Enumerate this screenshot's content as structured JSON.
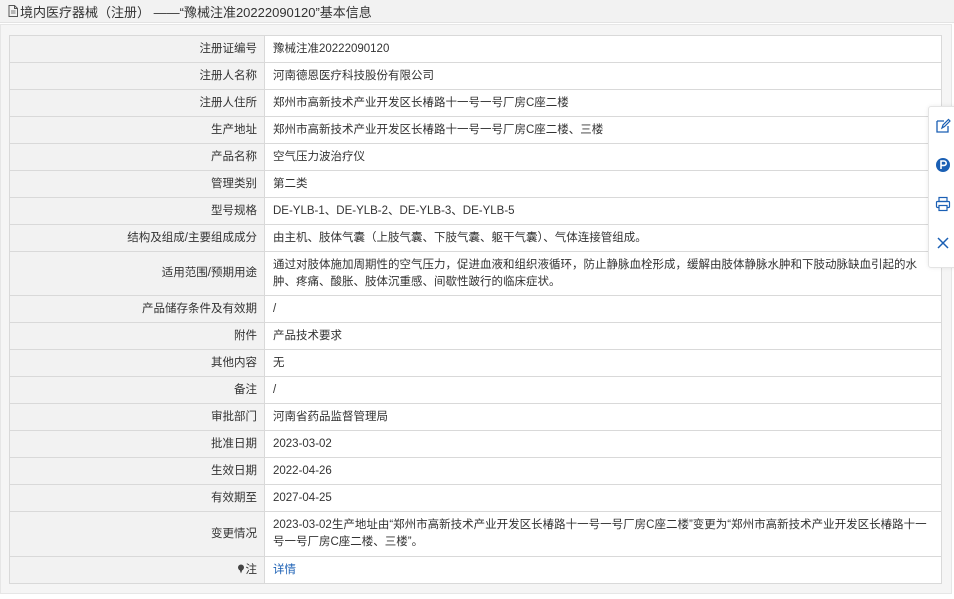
{
  "header": {
    "title": "境内医疗器械（注册） ——“豫械注准20222090120”基本信息"
  },
  "rows": [
    {
      "label": "注册证编号",
      "value": "豫械注准20222090120"
    },
    {
      "label": "注册人名称",
      "value": "河南德恩医疗科技股份有限公司"
    },
    {
      "label": "注册人住所",
      "value": "郑州市高新技术产业开发区长椿路十一号一号厂房C座二楼"
    },
    {
      "label": "生产地址",
      "value": "郑州市高新技术产业开发区长椿路十一号一号厂房C座二楼、三楼"
    },
    {
      "label": "产品名称",
      "value": "空气压力波治疗仪"
    },
    {
      "label": "管理类别",
      "value": "第二类"
    },
    {
      "label": "型号规格",
      "value": "DE-YLB-1、DE-YLB-2、DE-YLB-3、DE-YLB-5"
    },
    {
      "label": "结构及组成/主要组成成分",
      "value": "由主机、肢体气囊（上肢气囊、下肢气囊、躯干气囊）、气体连接管组成。"
    },
    {
      "label": "适用范围/预期用途",
      "value": "通过对肢体施加周期性的空气压力，促进血液和组织液循环，防止静脉血栓形成，缓解由肢体静脉水肿和下肢动脉缺血引起的水肿、疼痛、酸胀、肢体沉重感、间歇性跛行的临床症状。"
    },
    {
      "label": "产品储存条件及有效期",
      "value": "/"
    },
    {
      "label": "附件",
      "value": "产品技术要求"
    },
    {
      "label": "其他内容",
      "value": "无"
    },
    {
      "label": "备注",
      "value": "/"
    },
    {
      "label": "审批部门",
      "value": "河南省药品监督管理局"
    },
    {
      "label": "批准日期",
      "value": "2023-03-02"
    },
    {
      "label": "生效日期",
      "value": "2022-04-26"
    },
    {
      "label": "有效期至",
      "value": "2027-04-25"
    },
    {
      "label": "变更情况",
      "value": "2023-03-02生产地址由“郑州市高新技术产业开发区长椿路十一号一号厂房C座二楼”变更为“郑州市高新技术产业开发区长椿路十一号一号厂房C座二楼、三楼”。"
    }
  ],
  "note_row": {
    "label": "注",
    "link": "详情"
  },
  "side_toolbar": {
    "icons": [
      "edit-icon",
      "parking-icon",
      "print-icon",
      "close-icon"
    ],
    "accent": "#1a5fb4"
  }
}
